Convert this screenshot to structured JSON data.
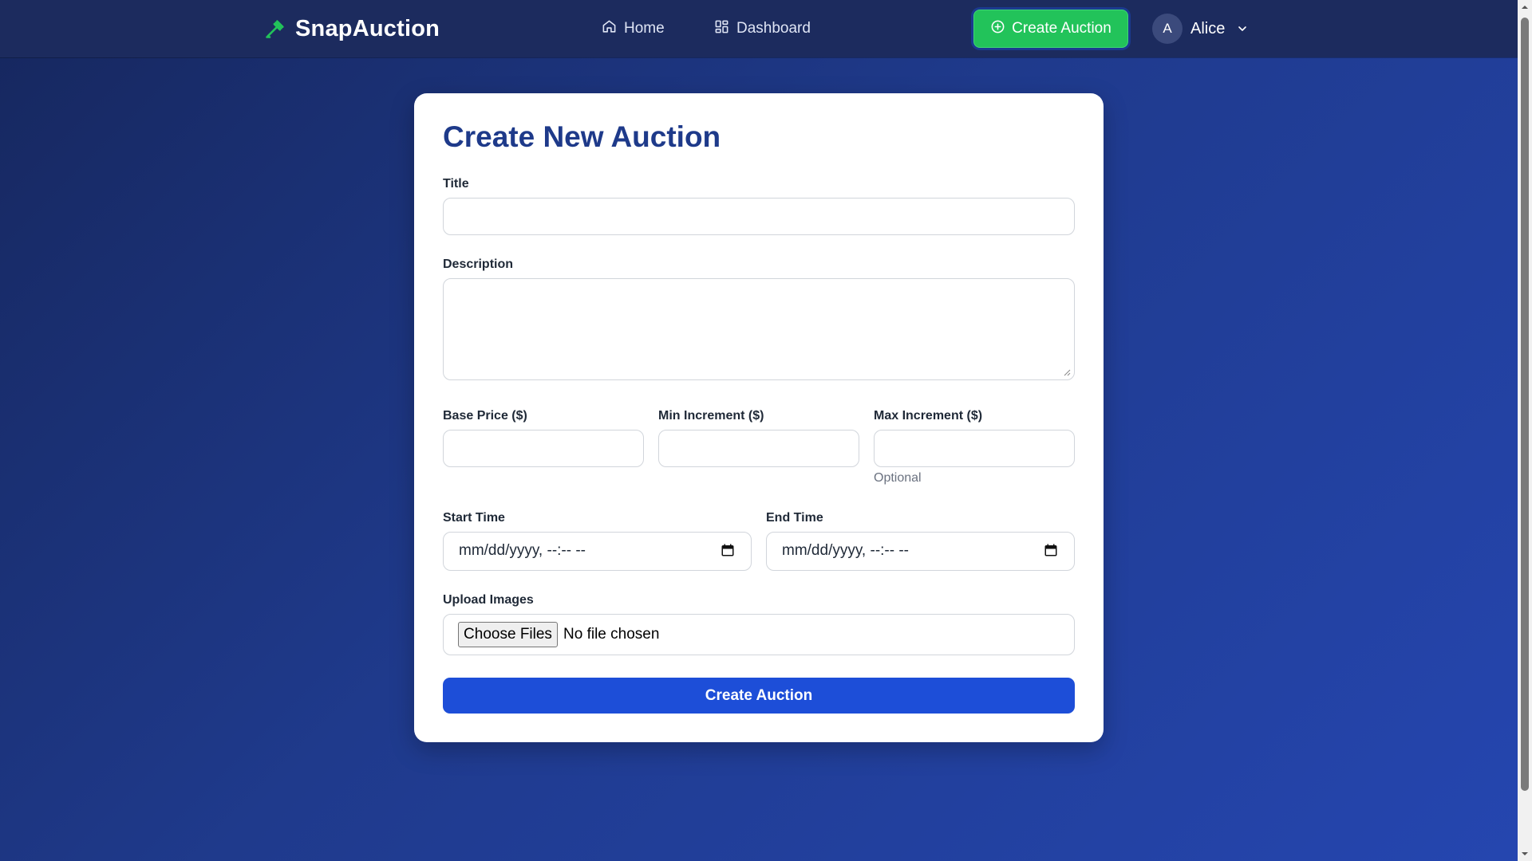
{
  "navbar": {
    "brand": "SnapAuction",
    "home_label": "Home",
    "dashboard_label": "Dashboard",
    "create_button_label": "Create Auction",
    "user": {
      "initial": "A",
      "name": "Alice"
    }
  },
  "form": {
    "title": "Create New Auction",
    "fields": {
      "title_label": "Title",
      "description_label": "Description",
      "base_price_label": "Base Price ($)",
      "min_increment_label": "Min Increment ($)",
      "max_increment_label": "Max Increment ($)",
      "max_increment_hint": "Optional",
      "start_time_label": "Start Time",
      "start_time_value": "mm/dd/yyyy, --:-- --",
      "end_time_label": "End Time",
      "end_time_value": "mm/dd/yyyy, --:-- --",
      "upload_label": "Upload Images",
      "choose_files_label": "Choose Files",
      "no_file_text": "No file chosen"
    },
    "submit_label": "Create Auction"
  },
  "colors": {
    "nav_bg": "#1c2b5e",
    "brand_accent": "#22c35a",
    "heading": "#1e3a8a",
    "primary_button": "#1d4ed8"
  },
  "icons": {
    "brand": "gavel-icon",
    "home": "home-icon",
    "dashboard": "dashboard-grid-icon",
    "create": "plus-circle-icon",
    "user_menu": "chevron-down-icon",
    "date": "calendar-icon"
  }
}
